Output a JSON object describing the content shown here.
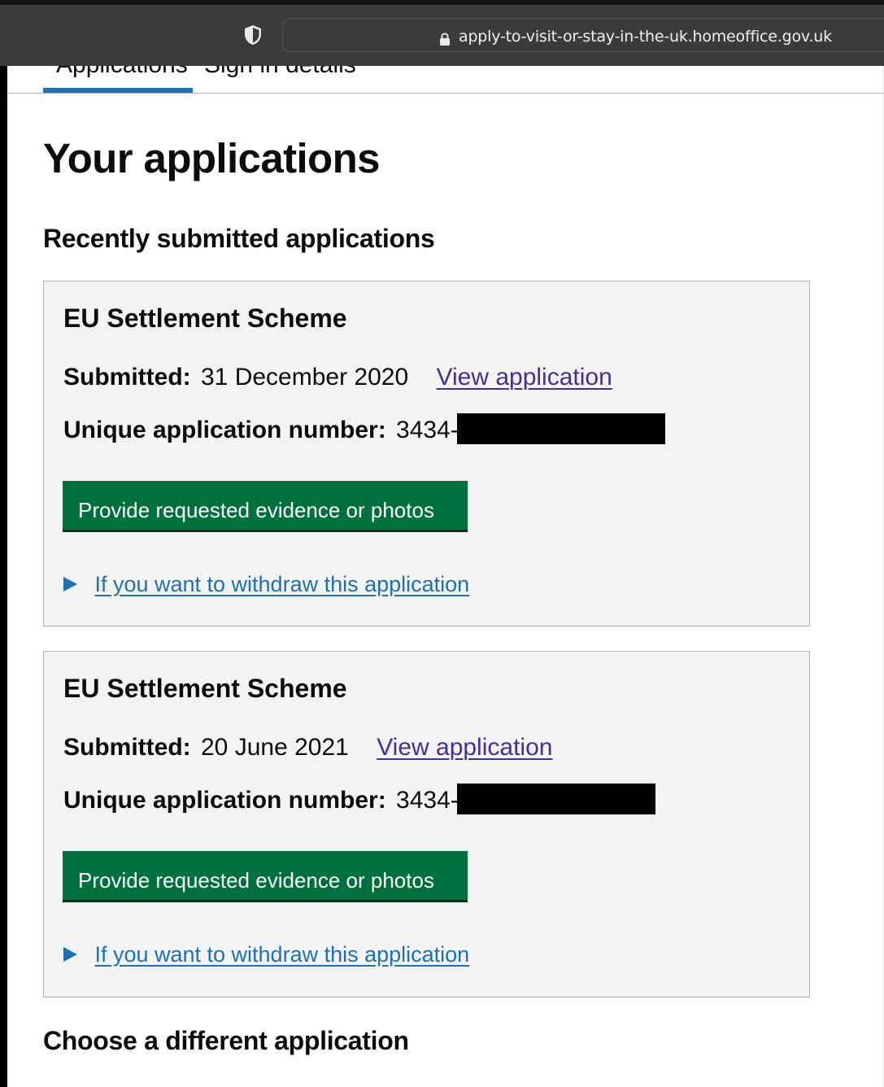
{
  "browser": {
    "url": "apply-to-visit-or-stay-in-the-uk.homeoffice.gov.uk"
  },
  "tabs": [
    {
      "label": "Applications",
      "active": true
    },
    {
      "label": "Sign in details",
      "active": false
    }
  ],
  "page_title": "Your applications",
  "recent_heading": "Recently submitted applications",
  "applications": [
    {
      "title": "EU Settlement Scheme",
      "submitted_label": "Submitted:",
      "submitted_value": "31 December 2020",
      "view_link": "View application",
      "uan_label": "Unique application number:",
      "uan_value": "3434-",
      "button_label": "Provide requested evidence or photos",
      "withdraw_link": "If you want to withdraw this application"
    },
    {
      "title": "EU Settlement Scheme",
      "submitted_label": "Submitted:",
      "submitted_value": "20 June 2021",
      "view_link": "View application",
      "uan_label": "Unique application number:",
      "uan_value": "3434-",
      "button_label": "Provide requested evidence or photos",
      "withdraw_link": "If you want to withdraw this application"
    }
  ],
  "choose_heading": "Choose a different application",
  "colors": {
    "button_green": "#00703c",
    "link_blue": "#1d70b8",
    "visited_link": "#4c2c92",
    "card_bg": "#f3f3f3"
  }
}
